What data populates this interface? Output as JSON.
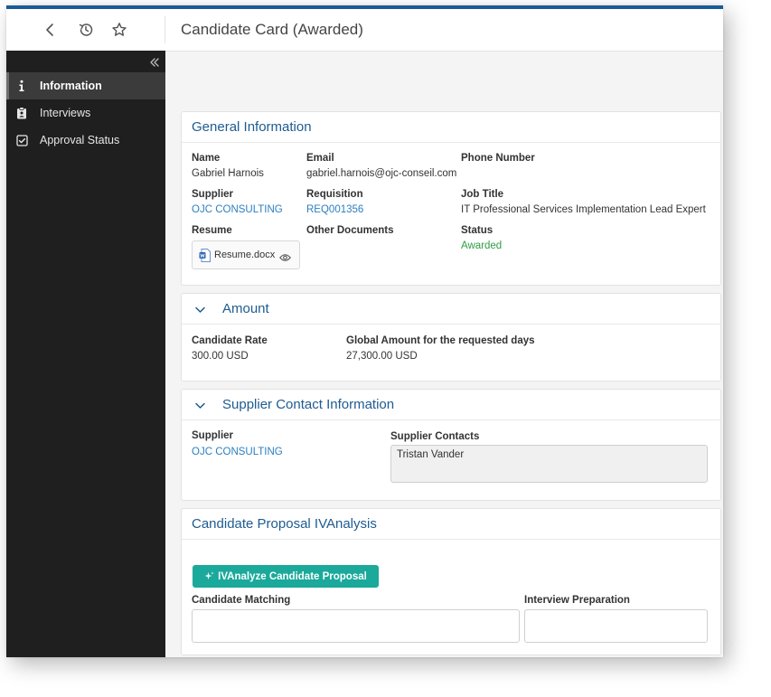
{
  "header": {
    "title": "Candidate Card (Awarded)",
    "icons": [
      "back-icon",
      "history-icon",
      "star-icon"
    ]
  },
  "sidebar": {
    "collapse_icon": "double-chevron-left-icon",
    "items": [
      {
        "label": "Information",
        "icon": "info-icon",
        "active": true
      },
      {
        "label": "Interviews",
        "icon": "clipboard-icon",
        "active": false
      },
      {
        "label": "Approval Status",
        "icon": "checkbox-icon",
        "active": false
      }
    ]
  },
  "general": {
    "title": "General Information",
    "name_label": "Name",
    "name_value": "Gabriel Harnois",
    "email_label": "Email",
    "email_value": "gabriel.harnois@ojc-conseil.com",
    "phone_label": "Phone Number",
    "supplier_label": "Supplier",
    "supplier_value": "OJC CONSULTING",
    "requisition_label": "Requisition",
    "requisition_value": "REQ001356",
    "jobtitle_label": "Job Title",
    "jobtitle_value": "IT Professional Services Implementation Lead Expert",
    "resume_label": "Resume",
    "resume_file": "Resume.docx",
    "other_docs_label": "Other Documents",
    "status_label": "Status",
    "status_value": "Awarded"
  },
  "amount": {
    "title": "Amount",
    "rate_label": "Candidate Rate",
    "rate_value": "300.00 USD",
    "global_label": "Global Amount for the requested days",
    "global_value": "27,300.00 USD"
  },
  "supplier_contact": {
    "title": "Supplier Contact Information",
    "supplier_label": "Supplier",
    "supplier_value": "OJC CONSULTING",
    "contacts_label": "Supplier Contacts",
    "contacts_value": "Tristan Vander"
  },
  "proposal": {
    "title": "Candidate Proposal IVAnalysis",
    "button_label": "IVAnalyze Candidate Proposal",
    "matching_label": "Candidate Matching",
    "interview_label": "Interview Preparation"
  },
  "colors": {
    "accent": "#1a5b96",
    "link": "#2c7fc1",
    "status_green": "#2f9e44",
    "button_teal": "#1aa99b",
    "sidebar_bg": "#1f1f1f"
  }
}
